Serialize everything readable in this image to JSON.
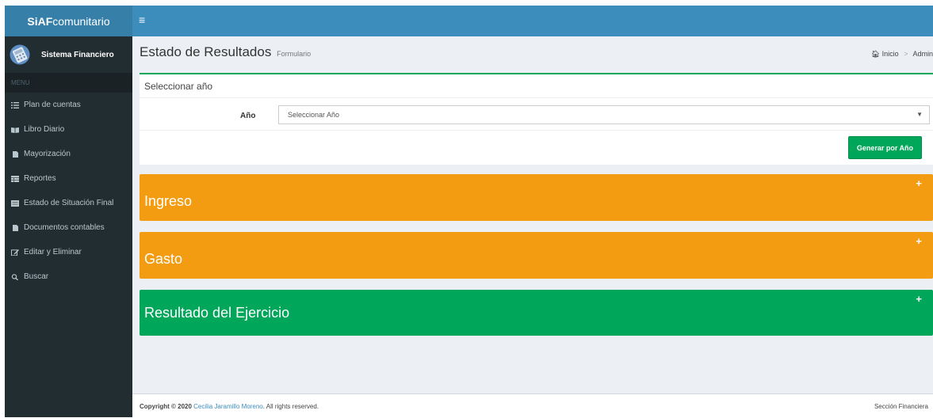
{
  "brand": {
    "bold": "SiAF",
    "rest": "comunitario"
  },
  "header": {
    "toggle_icon": "bars-icon"
  },
  "user": {
    "name": "Sistema Financiero"
  },
  "menu": {
    "header": "MENU",
    "items": [
      {
        "label": "Plan de cuentas",
        "icon": "list-icon"
      },
      {
        "label": "Libro Diario",
        "icon": "book-icon"
      },
      {
        "label": "Mayorización",
        "icon": "file-icon"
      },
      {
        "label": "Reportes",
        "icon": "table-icon"
      },
      {
        "label": "Estado de Situación Final",
        "icon": "report-icon"
      },
      {
        "label": "Documentos contables",
        "icon": "document-icon"
      },
      {
        "label": "Editar y Eliminar",
        "icon": "edit-icon"
      },
      {
        "label": "Buscar",
        "icon": "search-icon"
      }
    ]
  },
  "page": {
    "title": "Estado de Resultados",
    "subtitle": "Formulario",
    "breadcrumb": {
      "home": "Inicio",
      "current": "Admin"
    }
  },
  "form": {
    "title": "Seleccionar año",
    "year_label": "Año",
    "year_select": "Seleccionar Año",
    "generate_button": "Generar por Año"
  },
  "panels": [
    {
      "title": "Ingreso",
      "color": "#f39c12"
    },
    {
      "title": "Gasto",
      "color": "#f39c12"
    },
    {
      "title": "Resultado del Ejercicio",
      "color": "#00a65a"
    }
  ],
  "footer": {
    "copyright_prefix": "Copyright © 2020",
    "author": "Cecilia Jaramillo Moreno",
    "rights": ". All rights reserved.",
    "section": "Sección Financiera"
  }
}
